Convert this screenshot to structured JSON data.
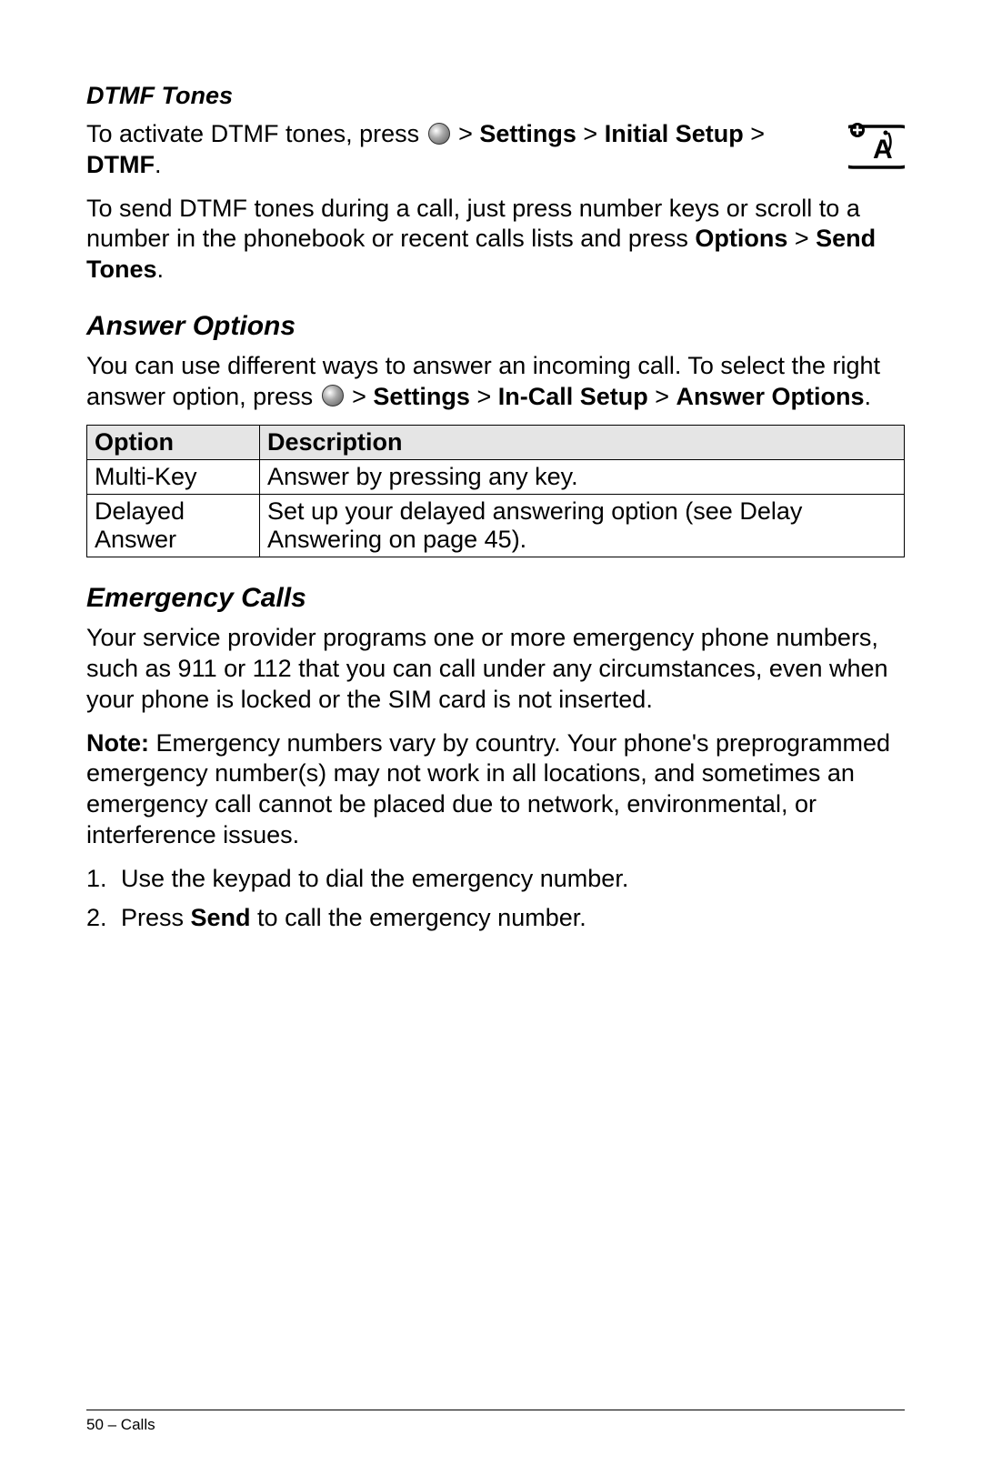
{
  "dtmf": {
    "heading": "DTMF Tones",
    "p1_pre": "To activate DTMF tones, press ",
    "p1_mid": " > ",
    "p1_b1": "Settings",
    "p1_sep": " > ",
    "p1_b2": "Initial Setup",
    "p1_b3": "DTMF",
    "p1_end": ".",
    "p2_a": "To send DTMF tones during a call, just press number keys or scroll to a number in the phonebook or recent calls lists and press ",
    "p2_b": "Options",
    "p2_s": " > ",
    "p2_c": "Send Tones",
    "p2_end": "."
  },
  "answer": {
    "heading": "Answer Options",
    "p1_a": "You can use different ways to answer an incoming call. To select the right answer option, press ",
    "p1_s1": " > ",
    "p1_b1": "Settings",
    "p1_s2": " > ",
    "p1_b2": "In-Call Setup",
    "p1_s3": " > ",
    "p1_b3": "Answer Options",
    "p1_end": ".",
    "table": {
      "h1": "Option",
      "h2": "Description",
      "r1c1": "Multi-Key",
      "r1c2": "Answer by pressing any key.",
      "r2c1": "Delayed Answer",
      "r2c2": "Set up your delayed answering option (see Delay Answering on page 45)."
    }
  },
  "emergency": {
    "heading": "Emergency Calls",
    "p1": "Your service provider programs one or more emergency phone numbers, such as 911 or 112 that you can call under any circumstances, even when your phone is locked or the SIM card is not inserted.",
    "p2_b": "Note:",
    "p2_a": " Emergency numbers vary by country. Your phone's preprogrammed emergency number(s) may not work in all locations, and sometimes an emergency call cannot be placed due to network, environmental, or interference issues.",
    "li1": "Use the keypad to dial the emergency number.",
    "li2_a": "Press ",
    "li2_b": "Send",
    "li2_c": " to call the emergency number."
  },
  "footer": "50 – Calls"
}
